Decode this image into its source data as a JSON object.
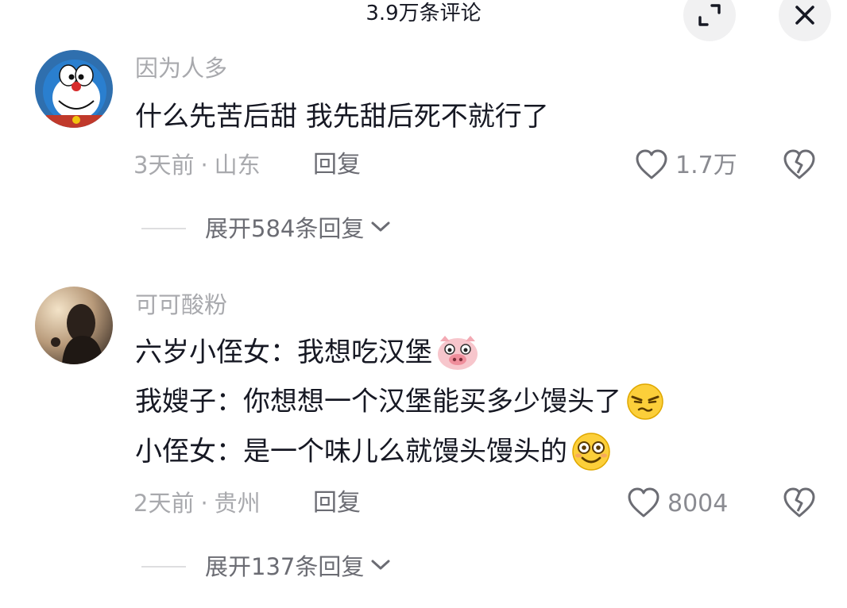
{
  "header": {
    "title": "3.9万条评论",
    "expand_icon": "expand-arrow-icon",
    "close_icon": "close-x-icon"
  },
  "comments": [
    {
      "username": "因为人多",
      "avatar_icon": "cartoon-cat-avatar",
      "lines": [
        "什么先苦后甜 我先甜后死不就行了"
      ],
      "time": "3天前",
      "location": "山东",
      "reply_label": "回复",
      "likes": "1.7万",
      "expand_label": "展开584条回复"
    },
    {
      "username": "可可酸粉",
      "avatar_icon": "photo-avatar",
      "lines": [
        "六岁小侄女：我想吃汉堡",
        "我嫂子：你想想一个汉堡能买多少馒头了",
        "小侄女：是一个味儿么就馒头馒头的"
      ],
      "time": "2天前",
      "location": "贵州",
      "reply_label": "回复",
      "likes": "8004",
      "expand_label": "展开137条回复"
    }
  ],
  "meta_separator": "·",
  "colors": {
    "text_primary": "#161823",
    "text_secondary": "#a8a9ad",
    "button_bg": "#f1f1f2"
  }
}
